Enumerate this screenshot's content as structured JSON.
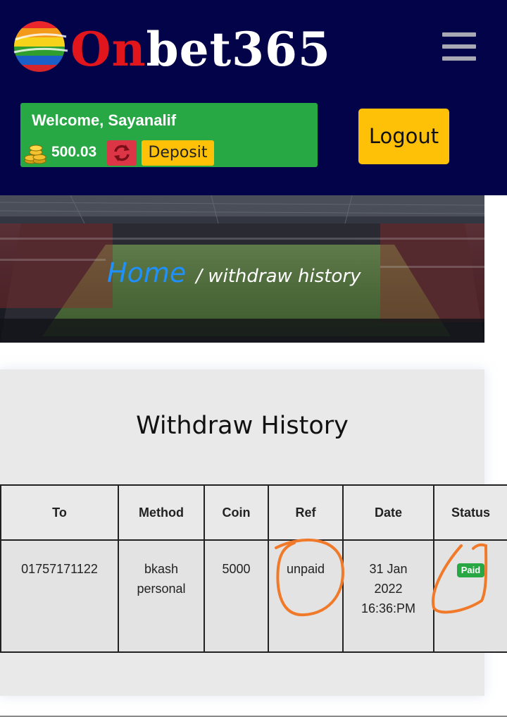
{
  "header": {
    "logo_prefix": "On",
    "logo_suffix": "bet365",
    "welcome": "Welcome, Sayanalif",
    "balance": "500.03",
    "deposit_label": "Deposit",
    "logout_label": "Logout"
  },
  "breadcrumb": {
    "home": "Home",
    "current": "/ withdraw history"
  },
  "page": {
    "title": "Withdraw History"
  },
  "table": {
    "headers": [
      "To",
      "Method",
      "Coin",
      "Ref",
      "Date",
      "Status"
    ],
    "rows": [
      {
        "to": "01757171122",
        "method_line1": "bkash",
        "method_line2": "personal",
        "coin": "5000",
        "ref": "unpaid",
        "date_line1": "31 Jan",
        "date_line2": "2022",
        "date_line3": "16:36:PM",
        "status": "Paid"
      }
    ]
  },
  "colors": {
    "header_bg": "#03034a",
    "welcome_green": "#28a745",
    "button_yellow": "#ffc107",
    "refresh_red": "#dc3545",
    "link_blue": "#1e90ff",
    "annotation_orange": "#f07a2a"
  },
  "icons": [
    "logo-ball-icon",
    "menu-icon",
    "coins-icon",
    "refresh-icon"
  ]
}
